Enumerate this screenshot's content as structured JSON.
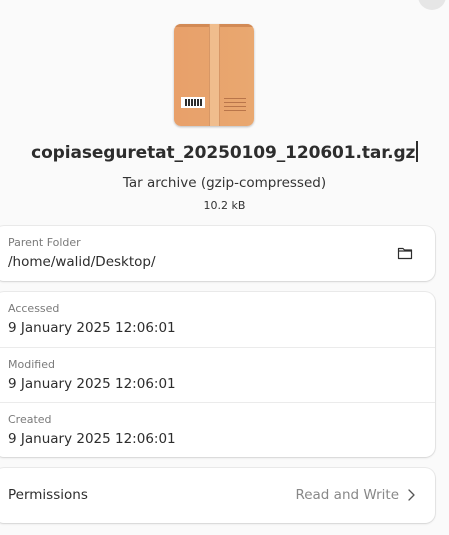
{
  "file": {
    "name": "copiaseguretat_20250109_120601.tar.gz",
    "type": "Tar archive (gzip-compressed)",
    "size": "10.2 kB",
    "icon": "package-archive-icon"
  },
  "parent_folder": {
    "label": "Parent Folder",
    "path": "/home/walid/Desktop/",
    "open_icon": "folder-icon"
  },
  "dates": {
    "accessed_label": "Accessed",
    "accessed": "9 January 2025 12:06:01",
    "modified_label": "Modified",
    "modified": "9 January 2025 12:06:01",
    "created_label": "Created",
    "created": "9 January 2025 12:06:01"
  },
  "permissions": {
    "label": "Permissions",
    "value": "Read and Write",
    "icon": "chevron-right-icon"
  }
}
